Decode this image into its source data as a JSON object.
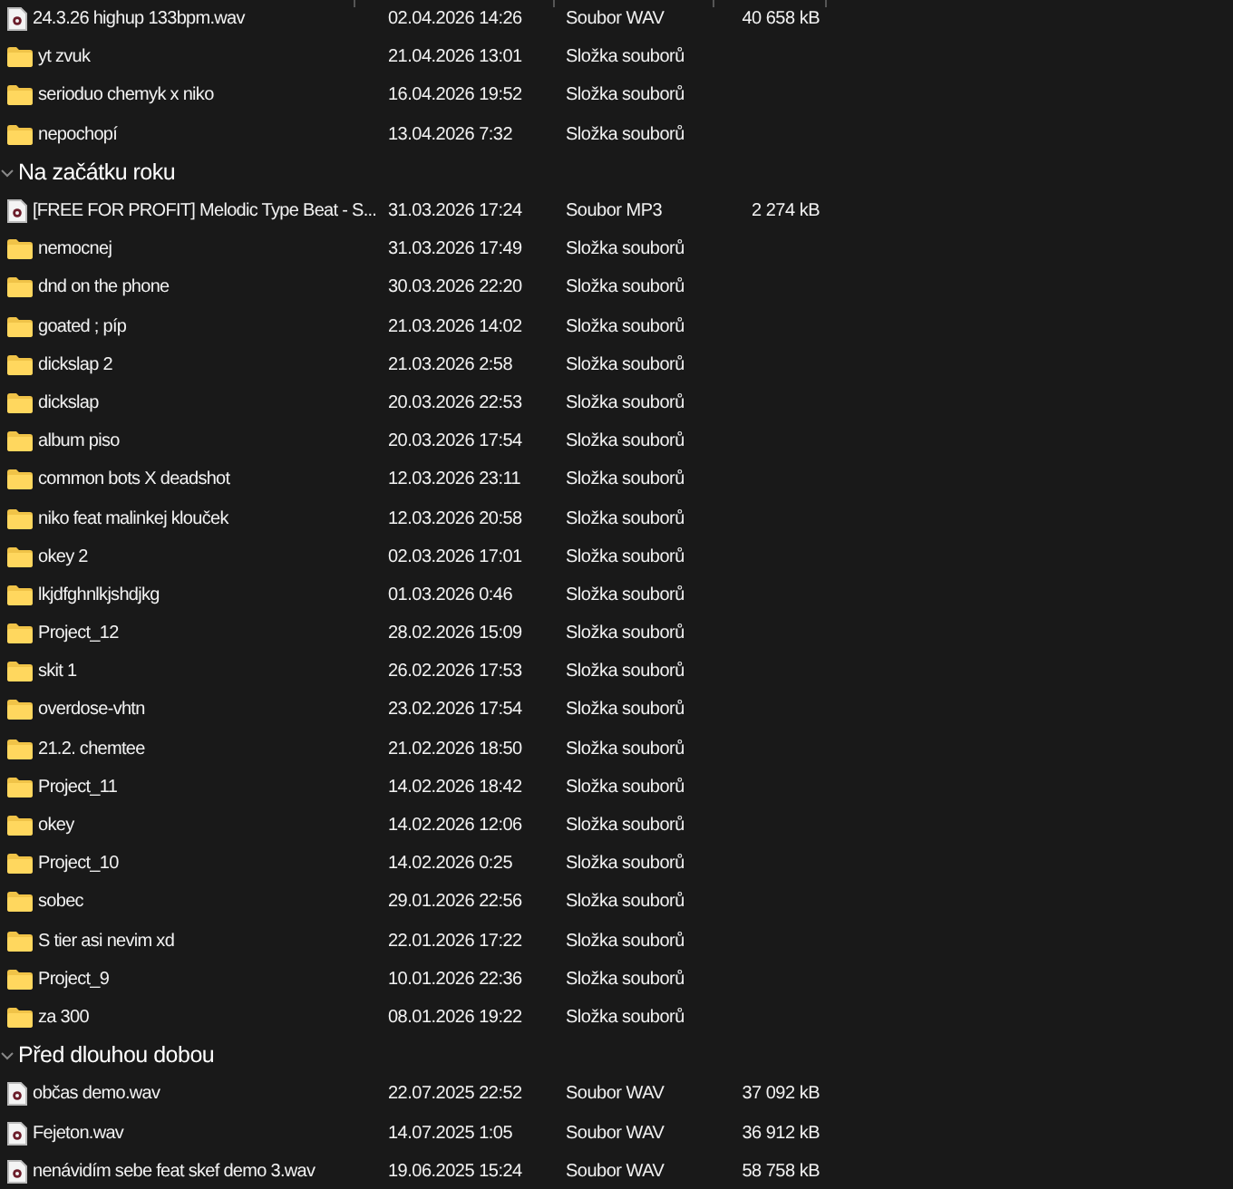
{
  "sections": [
    {
      "items": [
        {
          "kind": "file",
          "name": "24.3.26 highup 133bpm.wav",
          "date": "02.04.2026 14:26",
          "type": "Soubor WAV",
          "size": "40 658 kB"
        },
        {
          "kind": "folder",
          "name": "yt zvuk",
          "date": "21.04.2026 13:01",
          "type": "Složka souborů"
        },
        {
          "kind": "folder",
          "name": "serioduo chemyk x niko",
          "date": "16.04.2026 19:52",
          "type": "Složka souborů"
        },
        {
          "kind": "folder",
          "name": "nepochopí",
          "date": "13.04.2026 7:32",
          "type": "Složka souborů"
        }
      ]
    },
    {
      "title": "Na začátku roku",
      "expanded": true,
      "items": [
        {
          "kind": "file",
          "name": "[FREE FOR PROFIT] Melodic Type Beat - S...",
          "date": "31.03.2026 17:24",
          "type": "Soubor MP3",
          "size": "2 274 kB"
        },
        {
          "kind": "folder",
          "name": "nemocnej",
          "date": "31.03.2026 17:49",
          "type": "Složka souborů"
        },
        {
          "kind": "folder",
          "name": "dnd on the phone",
          "date": "30.03.2026 22:20",
          "type": "Složka souborů"
        },
        {
          "kind": "folder",
          "name": "goated ;  píp",
          "date": "21.03.2026 14:02",
          "type": "Složka souborů"
        },
        {
          "kind": "folder",
          "name": "dickslap 2",
          "date": "21.03.2026 2:58",
          "type": "Složka souborů"
        },
        {
          "kind": "folder",
          "name": "dickslap",
          "date": "20.03.2026 22:53",
          "type": "Složka souborů"
        },
        {
          "kind": "folder",
          "name": "album piso",
          "date": "20.03.2026 17:54",
          "type": "Složka souborů"
        },
        {
          "kind": "folder",
          "name": "common bots X deadshot",
          "date": "12.03.2026 23:11",
          "type": "Složka souborů"
        },
        {
          "kind": "folder",
          "name": "niko feat malinkej klouček",
          "date": "12.03.2026 20:58",
          "type": "Složka souborů"
        },
        {
          "kind": "folder",
          "name": "okey 2",
          "date": "02.03.2026 17:01",
          "type": "Složka souborů"
        },
        {
          "kind": "folder",
          "name": "lkjdfghnlkjshdjkg",
          "date": "01.03.2026 0:46",
          "type": "Složka souborů"
        },
        {
          "kind": "folder",
          "name": "Project_12",
          "date": "28.02.2026 15:09",
          "type": "Složka souborů"
        },
        {
          "kind": "folder",
          "name": "skit 1",
          "date": "26.02.2026 17:53",
          "type": "Složka souborů"
        },
        {
          "kind": "folder",
          "name": "overdose-vhtn",
          "date": "23.02.2026 17:54",
          "type": "Složka souborů"
        },
        {
          "kind": "folder",
          "name": "21.2. chemtee",
          "date": "21.02.2026 18:50",
          "type": "Složka souborů"
        },
        {
          "kind": "folder",
          "name": "Project_11",
          "date": "14.02.2026 18:42",
          "type": "Složka souborů"
        },
        {
          "kind": "folder",
          "name": "okey",
          "date": "14.02.2026 12:06",
          "type": "Složka souborů"
        },
        {
          "kind": "folder",
          "name": "Project_10",
          "date": "14.02.2026 0:25",
          "type": "Složka souborů"
        },
        {
          "kind": "folder",
          "name": "sobec",
          "date": "29.01.2026 22:56",
          "type": "Složka souborů"
        },
        {
          "kind": "folder",
          "name": "S tier asi nevim xd",
          "date": "22.01.2026 17:22",
          "type": "Složka souborů"
        },
        {
          "kind": "folder",
          "name": "Project_9",
          "date": "10.01.2026 22:36",
          "type": "Složka souborů"
        },
        {
          "kind": "folder",
          "name": "za 300",
          "date": "08.01.2026 19:22",
          "type": "Složka souborů"
        }
      ]
    },
    {
      "title": "Před dlouhou dobou",
      "expanded": true,
      "items": [
        {
          "kind": "file",
          "name": "občas demo.wav",
          "date": "22.07.2025 22:52",
          "type": "Soubor WAV",
          "size": "37 092 kB"
        },
        {
          "kind": "file",
          "name": "Fejeton.wav",
          "date": "14.07.2025 1:05",
          "type": "Soubor WAV",
          "size": "36 912 kB"
        },
        {
          "kind": "file",
          "name": "nenávidím sebe feat skef demo 3.wav",
          "date": "19.06.2025 15:24",
          "type": "Soubor WAV",
          "size": "58 758 kB"
        }
      ]
    }
  ]
}
